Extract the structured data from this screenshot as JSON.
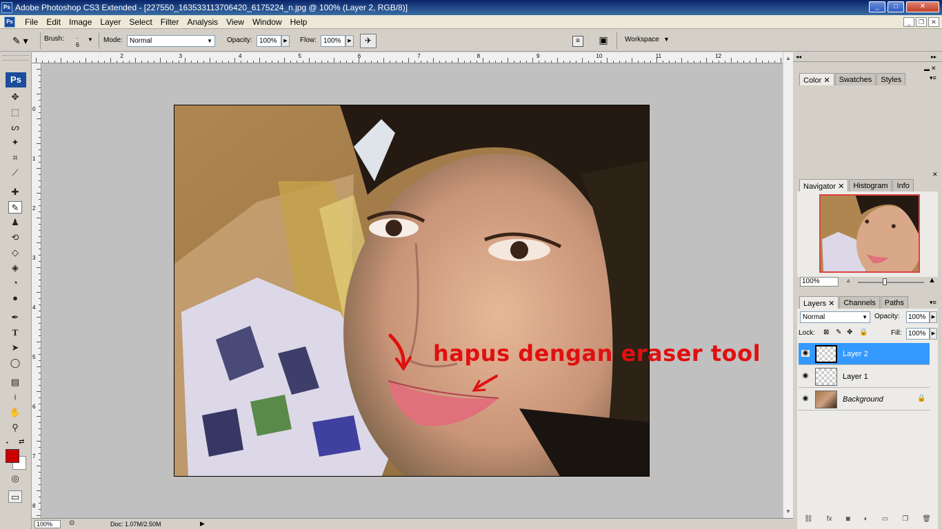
{
  "window": {
    "app_icon": "Ps",
    "title": "Adobe Photoshop CS3 Extended - [227550_163533113706420_6175224_n.jpg @ 100% (Layer 2, RGB/8)]",
    "controls": [
      "_",
      "□",
      "✕"
    ]
  },
  "menubar": {
    "doc_icon": "Ps",
    "items": [
      "File",
      "Edit",
      "Image",
      "Layer",
      "Select",
      "Filter",
      "Analysis",
      "View",
      "Window",
      "Help"
    ],
    "doc_controls": [
      "_",
      "❐",
      "✕"
    ]
  },
  "options": {
    "brush_label": "Brush:",
    "brush_size": "6",
    "mode_label": "Mode:",
    "mode_value": "Normal",
    "opacity_label": "Opacity:",
    "opacity_value": "100%",
    "flow_label": "Flow:",
    "flow_value": "100%",
    "workspace_label": "Workspace"
  },
  "toolbox": {
    "logo": "Ps"
  },
  "rulers": {
    "top": [
      "2",
      "3",
      "4",
      "5",
      "6",
      "7",
      "8",
      "9",
      "10",
      "11",
      "12"
    ],
    "left": [
      "0",
      "1",
      "2",
      "3",
      "4",
      "5",
      "6",
      "7",
      "8"
    ]
  },
  "canvas": {
    "annotation": "hapus dengan eraser tool"
  },
  "statusbar": {
    "zoom": "100%",
    "doc": "Doc: 1.07M/2.50M"
  },
  "panels": {
    "color_tabs": [
      "Color",
      "Swatches",
      "Styles"
    ],
    "navigator_tabs": [
      "Navigator",
      "Histogram",
      "Info"
    ],
    "navigator_zoom": "100%",
    "layers_tabs": [
      "Layers",
      "Channels",
      "Paths"
    ],
    "blend_mode": "Normal",
    "opacity_label": "Opacity:",
    "opacity_value": "100%",
    "lock_label": "Lock:",
    "fill_label": "Fill:",
    "fill_value": "100%",
    "layers": [
      {
        "name": "Layer 2"
      },
      {
        "name": "Layer 1"
      },
      {
        "name": "Background"
      }
    ]
  },
  "colors": {
    "foreground": "#cc0000",
    "background": "#ffffff",
    "selection": "#3399ff",
    "annotation": "#e01010"
  }
}
